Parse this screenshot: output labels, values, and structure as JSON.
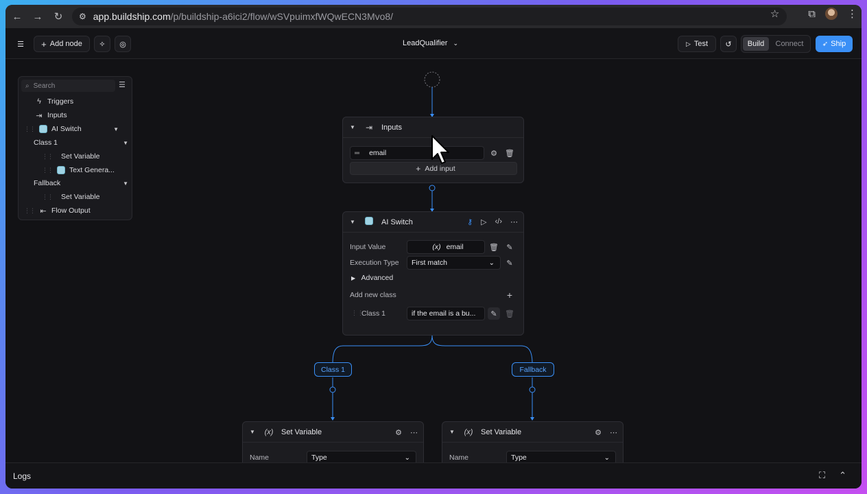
{
  "browser": {
    "url_host": "app.buildship.com",
    "url_path": "/p/buildship-a6ici2/flow/wSVpuimxfWQwECN3Mvo8/"
  },
  "toolbar": {
    "add_node_label": "Add node",
    "flow_title": "LeadQualifier",
    "test_label": "Test",
    "build_label": "Build",
    "connect_label": "Connect",
    "ship_label": "Ship"
  },
  "outline": {
    "search_placeholder": "Search",
    "items": [
      {
        "label": "Triggers",
        "icon": "bolt-icon"
      },
      {
        "label": "Inputs",
        "icon": "enter-arrow-icon"
      },
      {
        "label": "AI Switch",
        "icon": "ai-icon"
      },
      {
        "label": "Class 1"
      },
      {
        "label": "Set Variable"
      },
      {
        "label": "Text Genera..."
      },
      {
        "label": "Fallback"
      },
      {
        "label": "Set Variable"
      },
      {
        "label": "Flow Output",
        "icon": "output-arrow-icon"
      }
    ]
  },
  "inputs_node": {
    "title": "Inputs",
    "field_value": "email",
    "add_input_label": "Add input"
  },
  "switch_node": {
    "title": "AI Switch",
    "input_value_label": "Input Value",
    "input_value": "email",
    "execution_type_label": "Execution Type",
    "execution_type_value": "First match",
    "advanced_label": "Advanced",
    "add_class_label": "Add new class",
    "class_label": "Class 1",
    "class_value": "if the email is a bu..."
  },
  "branches": {
    "left": "Class 1",
    "right": "Fallback"
  },
  "set_var_left": {
    "title": "Set Variable",
    "name_label": "Name",
    "name_value": "Type"
  },
  "set_var_right": {
    "title": "Set Variable",
    "name_label": "Name",
    "name_value": "Type"
  },
  "logs": {
    "label": "Logs"
  },
  "colors": {
    "accent": "#3a8ff6",
    "canvas": "#121215",
    "node": "#1c1c20"
  }
}
